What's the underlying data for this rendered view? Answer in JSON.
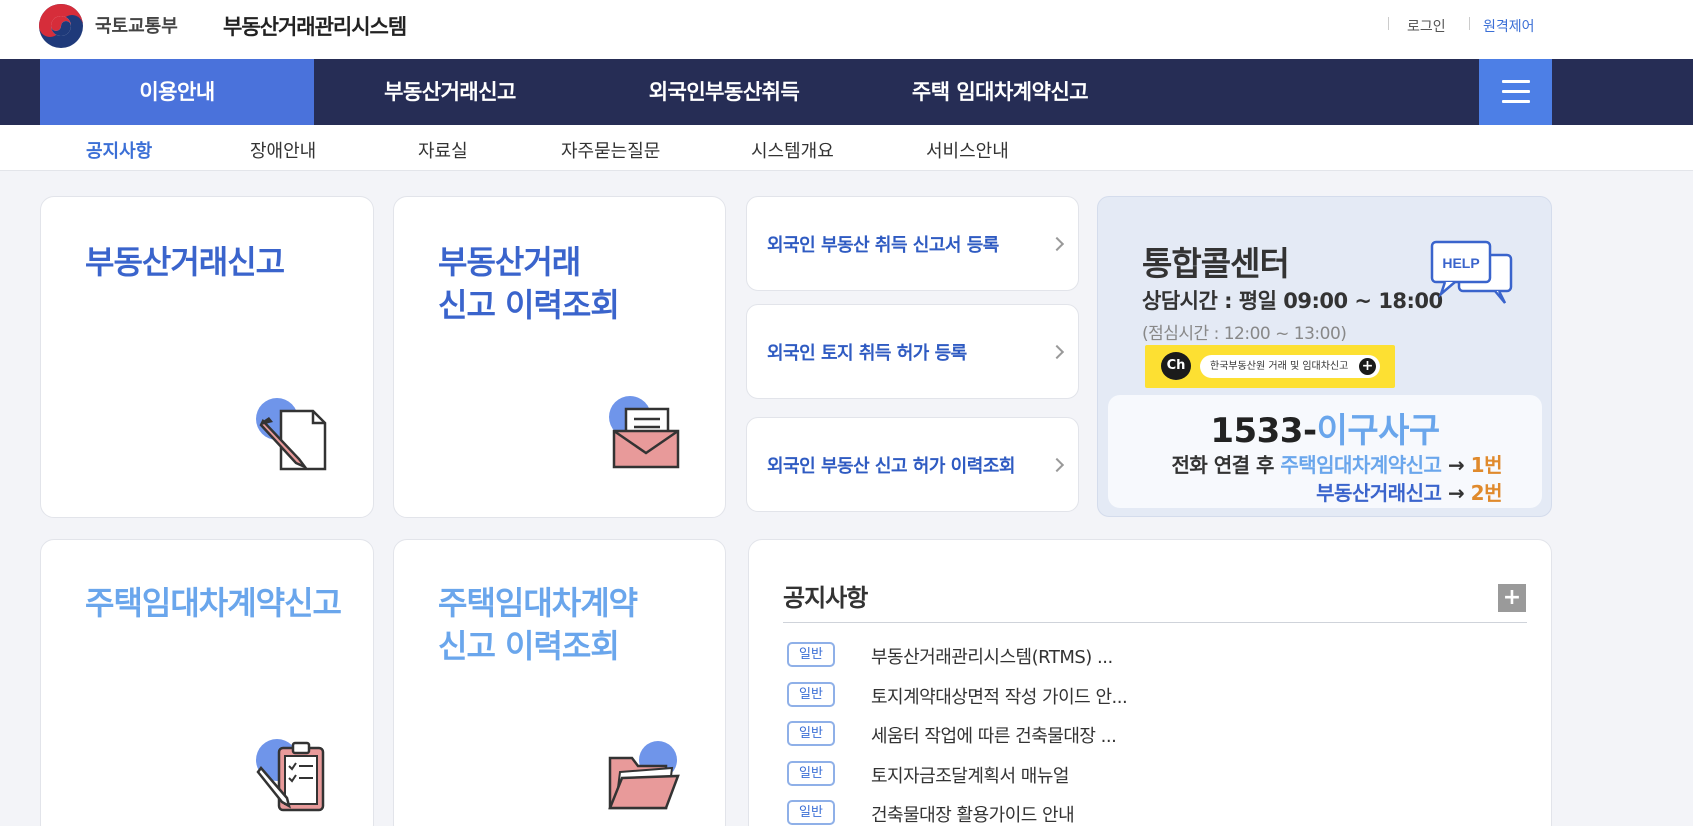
{
  "header": {
    "ministry": "국토교통부",
    "system_title": "부동산거래관리시스템",
    "login": "로그인",
    "remote": "원격제어"
  },
  "nav": {
    "items": [
      {
        "label": "이용안내",
        "active": true
      },
      {
        "label": "부동산거래신고",
        "active": false
      },
      {
        "label": "외국인부동산취득",
        "active": false
      },
      {
        "label": "주택 임대차계약신고",
        "active": false
      }
    ],
    "menu_icon": "hamburger-icon"
  },
  "subnav": {
    "items": [
      {
        "label": "공지사항",
        "active": true
      },
      {
        "label": "장애안내",
        "active": false
      },
      {
        "label": "자료실",
        "active": false
      },
      {
        "label": "자주묻는질문",
        "active": false
      },
      {
        "label": "시스템개요",
        "active": false
      },
      {
        "label": "서비스안내",
        "active": false
      }
    ]
  },
  "cards": {
    "report": {
      "line1": "부동산거래신고",
      "icon": "pencil-document-icon"
    },
    "history": {
      "line1": "부동산거래",
      "line2": "신고 이력조회",
      "icon": "mail-envelope-icon"
    },
    "lease": {
      "line1": "주택임대차계약신고",
      "icon": "clipboard-checklist-icon"
    },
    "lease_history": {
      "line1": "주택임대차계약",
      "line2": "신고 이력조회",
      "icon": "folder-icon"
    }
  },
  "links": [
    {
      "label": "외국인 부동산 취득 신고서 등록"
    },
    {
      "label": "외국인 토지 취득 허가 등록"
    },
    {
      "label": "외국인 부동산 신고 허가 이력조회"
    }
  ],
  "callcenter": {
    "title": "통합콜센터",
    "hours": "상담시간 : 평일 09:00 ~ 18:00",
    "lunch": "(점심시간 : 12:00 ~ 13:00)",
    "help_icon_text": "HELP",
    "kakao_ch": "Ch",
    "kakao_text": "한국부동산원 거래 및 임대차신고",
    "kakao_plus": "+",
    "phone_number": "1533-",
    "phone_word": "이구사구",
    "line1_prefix": "전화 연결 후",
    "line1_service": "주택임대차계약신고",
    "line1_arrow": "→",
    "line1_num": "1번",
    "line2_service": "부동산거래신고",
    "line2_arrow": "→",
    "line2_num": "2번"
  },
  "notice": {
    "title": "공지사항",
    "more": "+",
    "items": [
      {
        "badge": "일반",
        "text": "부동산거래관리시스템(RTMS) ..."
      },
      {
        "badge": "일반",
        "text": "토지계약대상면적 작성 가이드 안..."
      },
      {
        "badge": "일반",
        "text": "세움터 작업에 따른 건축물대장 ..."
      },
      {
        "badge": "일반",
        "text": "토지자금조달계획서 매뉴얼"
      },
      {
        "badge": "일반",
        "text": "건축물대장 활용가이드 안내"
      }
    ]
  },
  "colors": {
    "nav_bg": "#262d55",
    "nav_active": "#4a72db",
    "accent_blue": "#3a64cc",
    "light_blue": "#6aa6ec",
    "orange": "#e08a2c"
  }
}
